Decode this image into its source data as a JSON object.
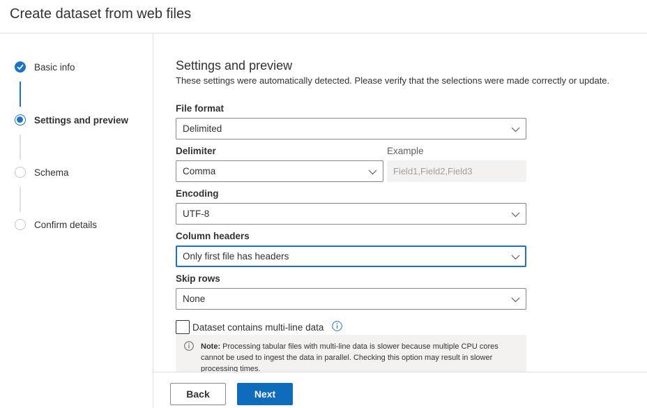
{
  "header": {
    "title": "Create dataset from web files"
  },
  "steps": [
    {
      "label": "Basic info",
      "state": "done"
    },
    {
      "label": "Settings and preview",
      "state": "current"
    },
    {
      "label": "Schema",
      "state": "todo"
    },
    {
      "label": "Confirm details",
      "state": "todo"
    }
  ],
  "section": {
    "title": "Settings and preview",
    "description": "These settings were automatically detected. Please verify that the selections were made correctly or update."
  },
  "fields": {
    "file_format": {
      "label": "File format",
      "value": "Delimited"
    },
    "delimiter": {
      "label": "Delimiter",
      "value": "Comma"
    },
    "example": {
      "label": "Example",
      "value": "Field1,Field2,Field3"
    },
    "encoding": {
      "label": "Encoding",
      "value": "UTF-8"
    },
    "column_headers": {
      "label": "Column headers",
      "value": "Only first file has headers"
    },
    "skip_rows": {
      "label": "Skip rows",
      "value": "None"
    }
  },
  "multiline": {
    "label": "Dataset contains multi-line data",
    "checked": false,
    "note_prefix": "Note:",
    "note_text": " Processing tabular files with multi-line data is slower because multiple CPU cores cannot be used to ingest the data in parallel. Checking this option may result in slower processing times."
  },
  "footer": {
    "back_label": "Back",
    "next_label": "Next"
  },
  "colors": {
    "accent": "#1a73c9",
    "primary_button": "#0f6cbd",
    "border": "#8a8886",
    "note_bg": "#f3f2f1"
  }
}
